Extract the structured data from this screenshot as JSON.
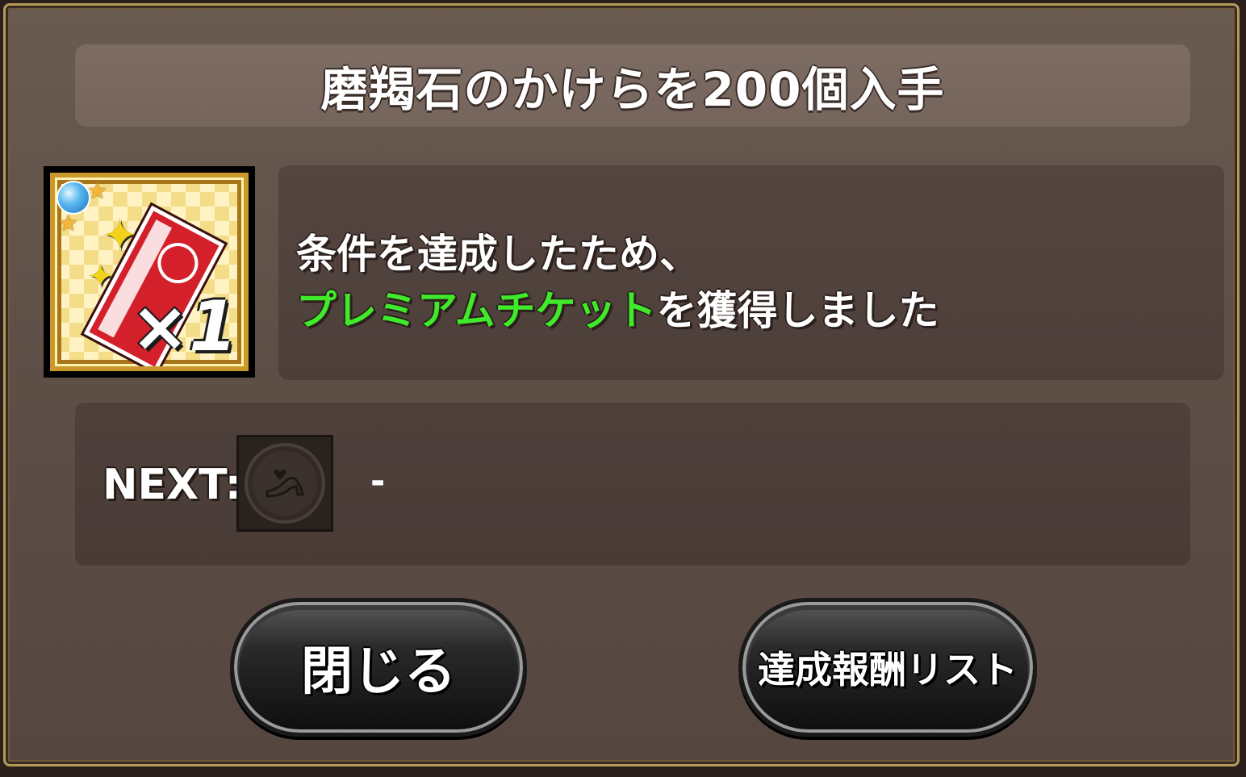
{
  "dialog": {
    "title": "磨羯石のかけらを200個入手"
  },
  "reward": {
    "quantity_text": "×1",
    "icon": "premium-ticket-icon"
  },
  "message": {
    "line1": "条件を達成したため、",
    "line2_highlight": "プレミアムチケット",
    "line2_rest": "を獲得しました",
    "highlight_color": "#3fea2a"
  },
  "next": {
    "label": "NEXT:",
    "icon": "glass-slipper-medal-icon",
    "value": "-"
  },
  "buttons": {
    "close_label": "閉じる",
    "reward_list_label": "達成報酬リスト"
  }
}
